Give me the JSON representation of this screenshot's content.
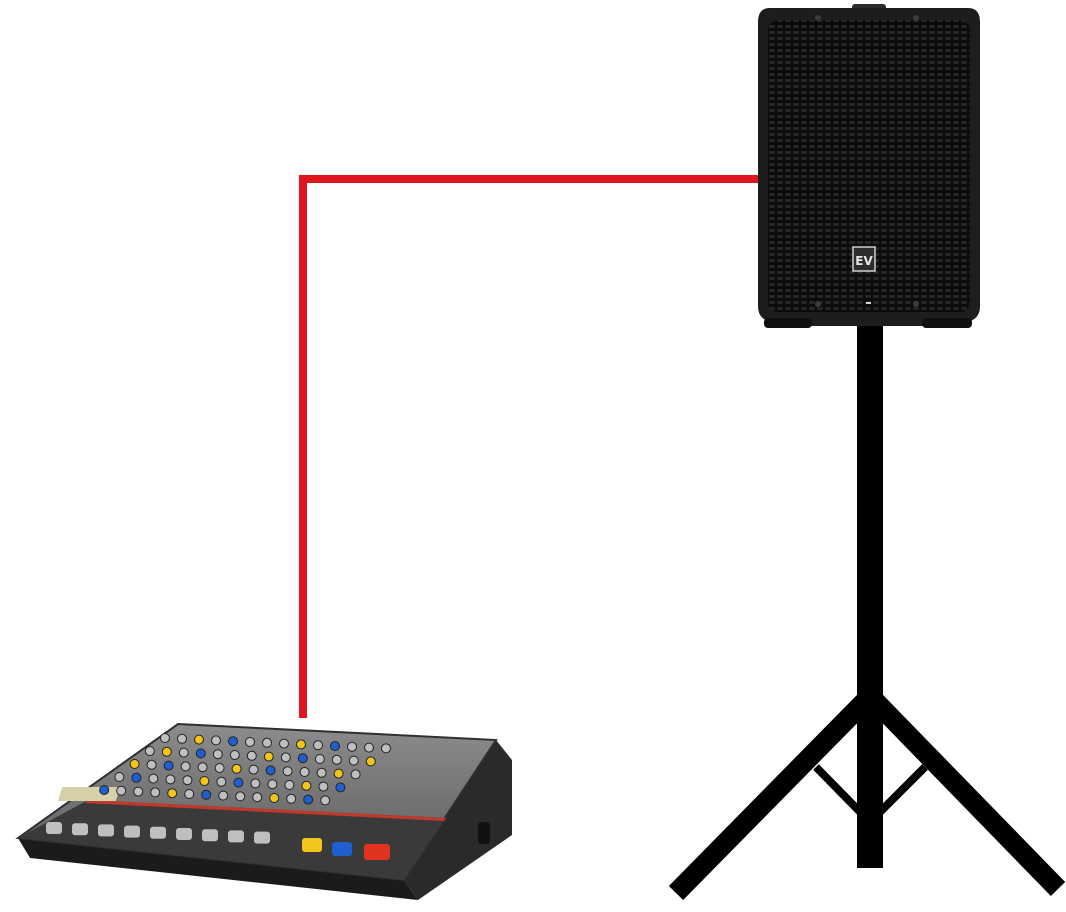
{
  "diagram": {
    "cable_color": "#e0161e",
    "speaker": {
      "logo_text": "EV"
    },
    "colors": {
      "speaker_body": "#1c1c1c",
      "grille": "#111111",
      "stand": "#000000",
      "mixer_body": "#2b2b2b",
      "mixer_panel": "#7a7a7a",
      "knob_yellow": "#f2c41c",
      "knob_blue": "#1f5fd1",
      "knob_red": "#e0341e",
      "knob_grey": "#bfbfbf"
    }
  }
}
